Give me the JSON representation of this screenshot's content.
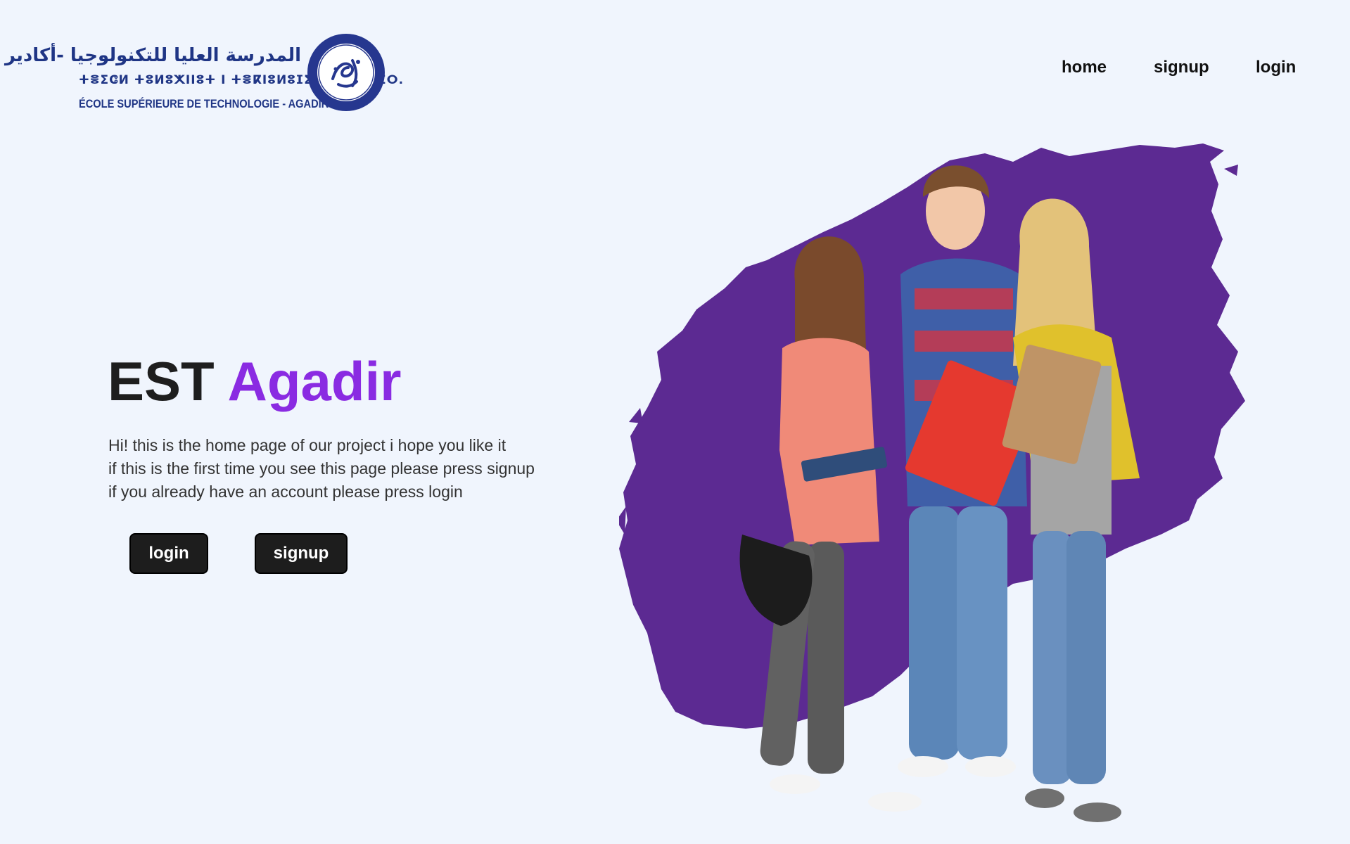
{
  "logo": {
    "arabic": "المدرسة العليا للتكنولوجيا -أكادير",
    "tifinagh": "ⵜⴻⵉⵛⵍ ⵜⵓⵍⵓⵅⵏⵏⵓⵜ Ⅰ ⵜⴻⴽⵏⵓⵍⵓⵊⵉⵜ – ⴰⴳⴰⴷⵉⵔ.",
    "latin": "ÉCOLE SUPÉRIEURE DE TECHNOLOGIE - AGADIR",
    "seal_icon": "university-seal-icon",
    "brand_color": "#1f3585"
  },
  "nav": {
    "items": [
      {
        "label": "home"
      },
      {
        "label": "signup"
      },
      {
        "label": "login"
      }
    ]
  },
  "hero": {
    "title_part1": "EST",
    "title_part2": "Agadir",
    "title_accent_color": "#8a2be2",
    "lines": [
      "Hi! this is the home page of our project i hope you like it",
      "if this is the first time you see this page please press signup",
      "if you already have an account please press login"
    ],
    "buttons": {
      "login": "login",
      "signup": "signup"
    },
    "image": {
      "description_icon": "students-photo",
      "splash_color": "#5c2a92"
    }
  }
}
